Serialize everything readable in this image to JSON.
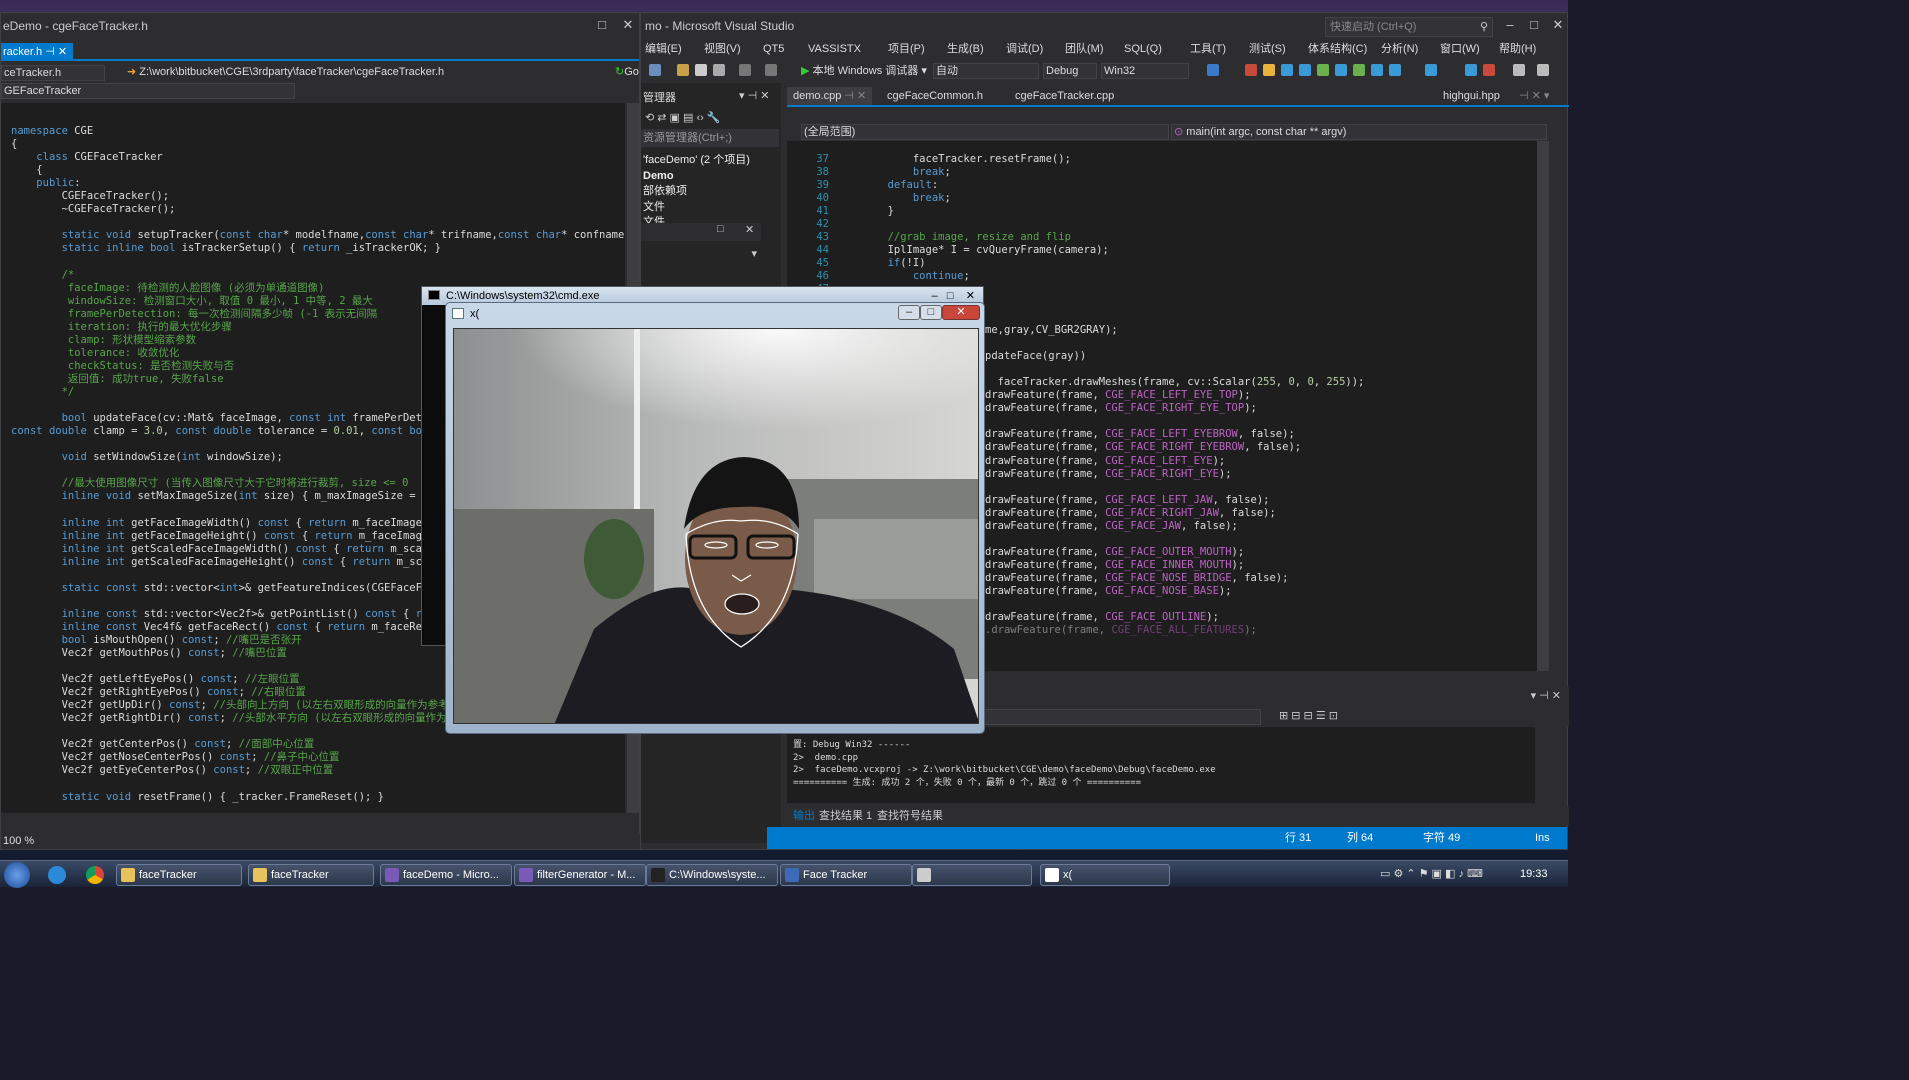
{
  "left_window": {
    "title": "eDemo - cgeFaceTracker.h",
    "tab": "racker.h",
    "nav_file": "ceTracker.h",
    "nav_path": "Z:\\work\\bitbucket\\CGE\\3rdparty\\faceTracker\\cgeFaceTracker.h",
    "go_label": "Go",
    "scope": "GEFaceTracker",
    "zoom": "100 %",
    "code": [
      "namespace CGE",
      "{",
      "    class CGEFaceTracker",
      "    {",
      "    public:",
      "        CGEFaceTracker();",
      "        ~CGEFaceTracker();",
      "",
      "        static void setupTracker(const char* modelfname,const char* trifname,const char* confname);",
      "        static inline bool isTrackerSetup() { return _isTrackerOK; }",
      "",
      "        /*",
      "         faceImage: 待检测的人脸图像 (必须为单通道图像)",
      "         windowSize: 检测窗口大小, 取值 0 最小, 1 中等, 2 最大",
      "         framePerDetection: 每一次检测间隔多少帧 (-1 表示无间隔",
      "         iteration: 执行的最大优化步骤",
      "         clamp: 形状模型缩索参数",
      "         tolerance: 收敛优化",
      "         checkStatus: 是否检测失败与否",
      "         返回值: 成功true, 失败false",
      "        */",
      "",
      "        bool updateFace(cv::Mat& faceImage, const int framePerDetection",
      "const double clamp = 3.0, const double tolerance = 0.01, const bool che",
      "",
      "        void setWindowSize(int windowSize);",
      "",
      "        //最大使用图像尺寸 (当传入图像尺寸大于它时将进行裁剪, size <= 0",
      "        inline void setMaxImageSize(int size) { m_maxImageSize = size;",
      "",
      "        inline int getFaceImageWidth() const { return m_faceImageSize.w",
      "        inline int getFaceImageHeight() const { return m_faceImageSize.",
      "        inline int getScaledFaceImageWidth() const { return m_scaledIma",
      "        inline int getScaledFaceImageHeight() const { return m_scaledIm",
      "",
      "        static const std::vector<int>& getFeatureIndices(CGEFaceFeature",
      "",
      "        inline const std::vector<Vec2f>& getPointList() const { return",
      "        inline const Vec4f& getFaceRect() const { return m_faceRect; }",
      "        bool isMouthOpen() const; //嘴巴是否张开",
      "        Vec2f getMouthPos() const; //嘴巴位置",
      "",
      "        Vec2f getLeftEyePos() const; //左眼位置",
      "        Vec2f getRightEyePos() const; //右眼位置",
      "        Vec2f getUpDir() const; //头部向上方向 (以左右双眼形成的向量作为参考",
      "        Vec2f getRightDir() const; //头部水平方向 (以左右双眼形成的向量作为",
      "",
      "        Vec2f getCenterPos() const; //面部中心位置",
      "        Vec2f getNoseCenterPos() const; //鼻子中心位置",
      "        Vec2f getEyeCenterPos() const; //双眼正中位置",
      "",
      "        static void resetFrame() { _tracker.FrameReset(); }"
    ]
  },
  "right_window": {
    "title": "mo - Microsoft Visual Studio",
    "quick_launch": "快速启动 (Ctrl+Q)",
    "menu": [
      "编辑(E)",
      "视图(V)",
      "QT5",
      "VASSISTX",
      "项目(P)",
      "生成(B)",
      "调试(D)",
      "团队(M)",
      "SQL(Q)",
      "工具(T)",
      "测试(S)",
      "体系结构(C)",
      "分析(N)",
      "窗口(W)",
      "帮助(H)"
    ],
    "run_label": "本地 Windows 调试器",
    "mode": "自动",
    "config": "Debug",
    "platform": "Win32",
    "solution": {
      "title": "管理器",
      "search": "资源管理器(Ctrl+;)",
      "items": [
        "'faceDemo' (2 个项目)",
        "Demo",
        "部依赖项",
        "文件",
        "文件"
      ]
    },
    "tabs": [
      "demo.cpp",
      "cgeFaceCommon.h",
      "cgeFaceTracker.cpp",
      "highgui.hpp"
    ],
    "scope": "(全局范围)",
    "member": "main(int argc, const char ** argv)",
    "line_numbers": [
      "37",
      "38",
      "39",
      "40",
      "41",
      "42",
      "43",
      "44",
      "45",
      "46",
      "47"
    ],
    "code_top": [
      "            faceTracker.resetFrame();",
      "            break;",
      "        default:",
      "            break;",
      "        }",
      "",
      "        //grab image, resize and flip",
      "        IplImage* I = cvQueryFrame(camera);",
      "        if(!I)",
      "            continue;",
      ""
    ],
    "code_visible": [
      "me,gray,CV_BGR2GRAY);",
      "",
      "pdateFace(gray))",
      "",
      "  faceTracker.drawMeshes(frame, cv::Scalar(255, 0, 0, 255));",
      "drawFeature(frame, CGE_FACE_LEFT_EYE_TOP);",
      "drawFeature(frame, CGE_FACE_RIGHT_EYE_TOP);",
      "",
      "drawFeature(frame, CGE_FACE_LEFT_EYEBROW, false);",
      "drawFeature(frame, CGE_FACE_RIGHT_EYEBROW, false);",
      "drawFeature(frame, CGE_FACE_LEFT_EYE);",
      "drawFeature(frame, CGE_FACE_RIGHT_EYE);",
      "",
      "drawFeature(frame, CGE_FACE_LEFT_JAW, false);",
      "drawFeature(frame, CGE_FACE_RIGHT_JAW, false);",
      "drawFeature(frame, CGE_FACE_JAW, false);",
      "",
      "drawFeature(frame, CGE_FACE_OUTER_MOUTH);",
      "drawFeature(frame, CGE_FACE_INNER_MOUTH);",
      "drawFeature(frame, CGE_FACE_NOSE_BRIDGE, false);",
      "drawFeature(frame, CGE_FACE_NOSE_BASE);",
      "",
      "drawFeature(frame, CGE_FACE_OUTLINE);",
      ".drawFeature(frame, CGE_FACE_ALL_FEATURES);"
    ],
    "output": [
      "置: Debug Win32 ------",
      "2>  demo.cpp",
      "2>  faceDemo.vcxproj -> Z:\\work\\bitbucket\\CGE\\demo\\faceDemo\\Debug\\faceDemo.exe",
      "========== 生成: 成功 2 个，失败 0 个，最新 0 个，跳过 0 个 =========="
    ],
    "output_tabs": [
      "输出",
      "查找结果 1",
      "查找符号结果"
    ],
    "status": {
      "line": "行 31",
      "col": "列 64",
      "char": "字符 49",
      "ins": "Ins"
    }
  },
  "cmd_window": {
    "title": "C:\\Windows\\system32\\cmd.exe"
  },
  "image_window": {
    "title": "x("
  },
  "taskbar": {
    "items": [
      "faceTracker",
      "faceTracker",
      "faceDemo - Micro...",
      "filterGenerator - M...",
      "C:\\Windows\\syste...",
      "Face Tracker",
      "",
      "x("
    ],
    "time": "19:33"
  }
}
